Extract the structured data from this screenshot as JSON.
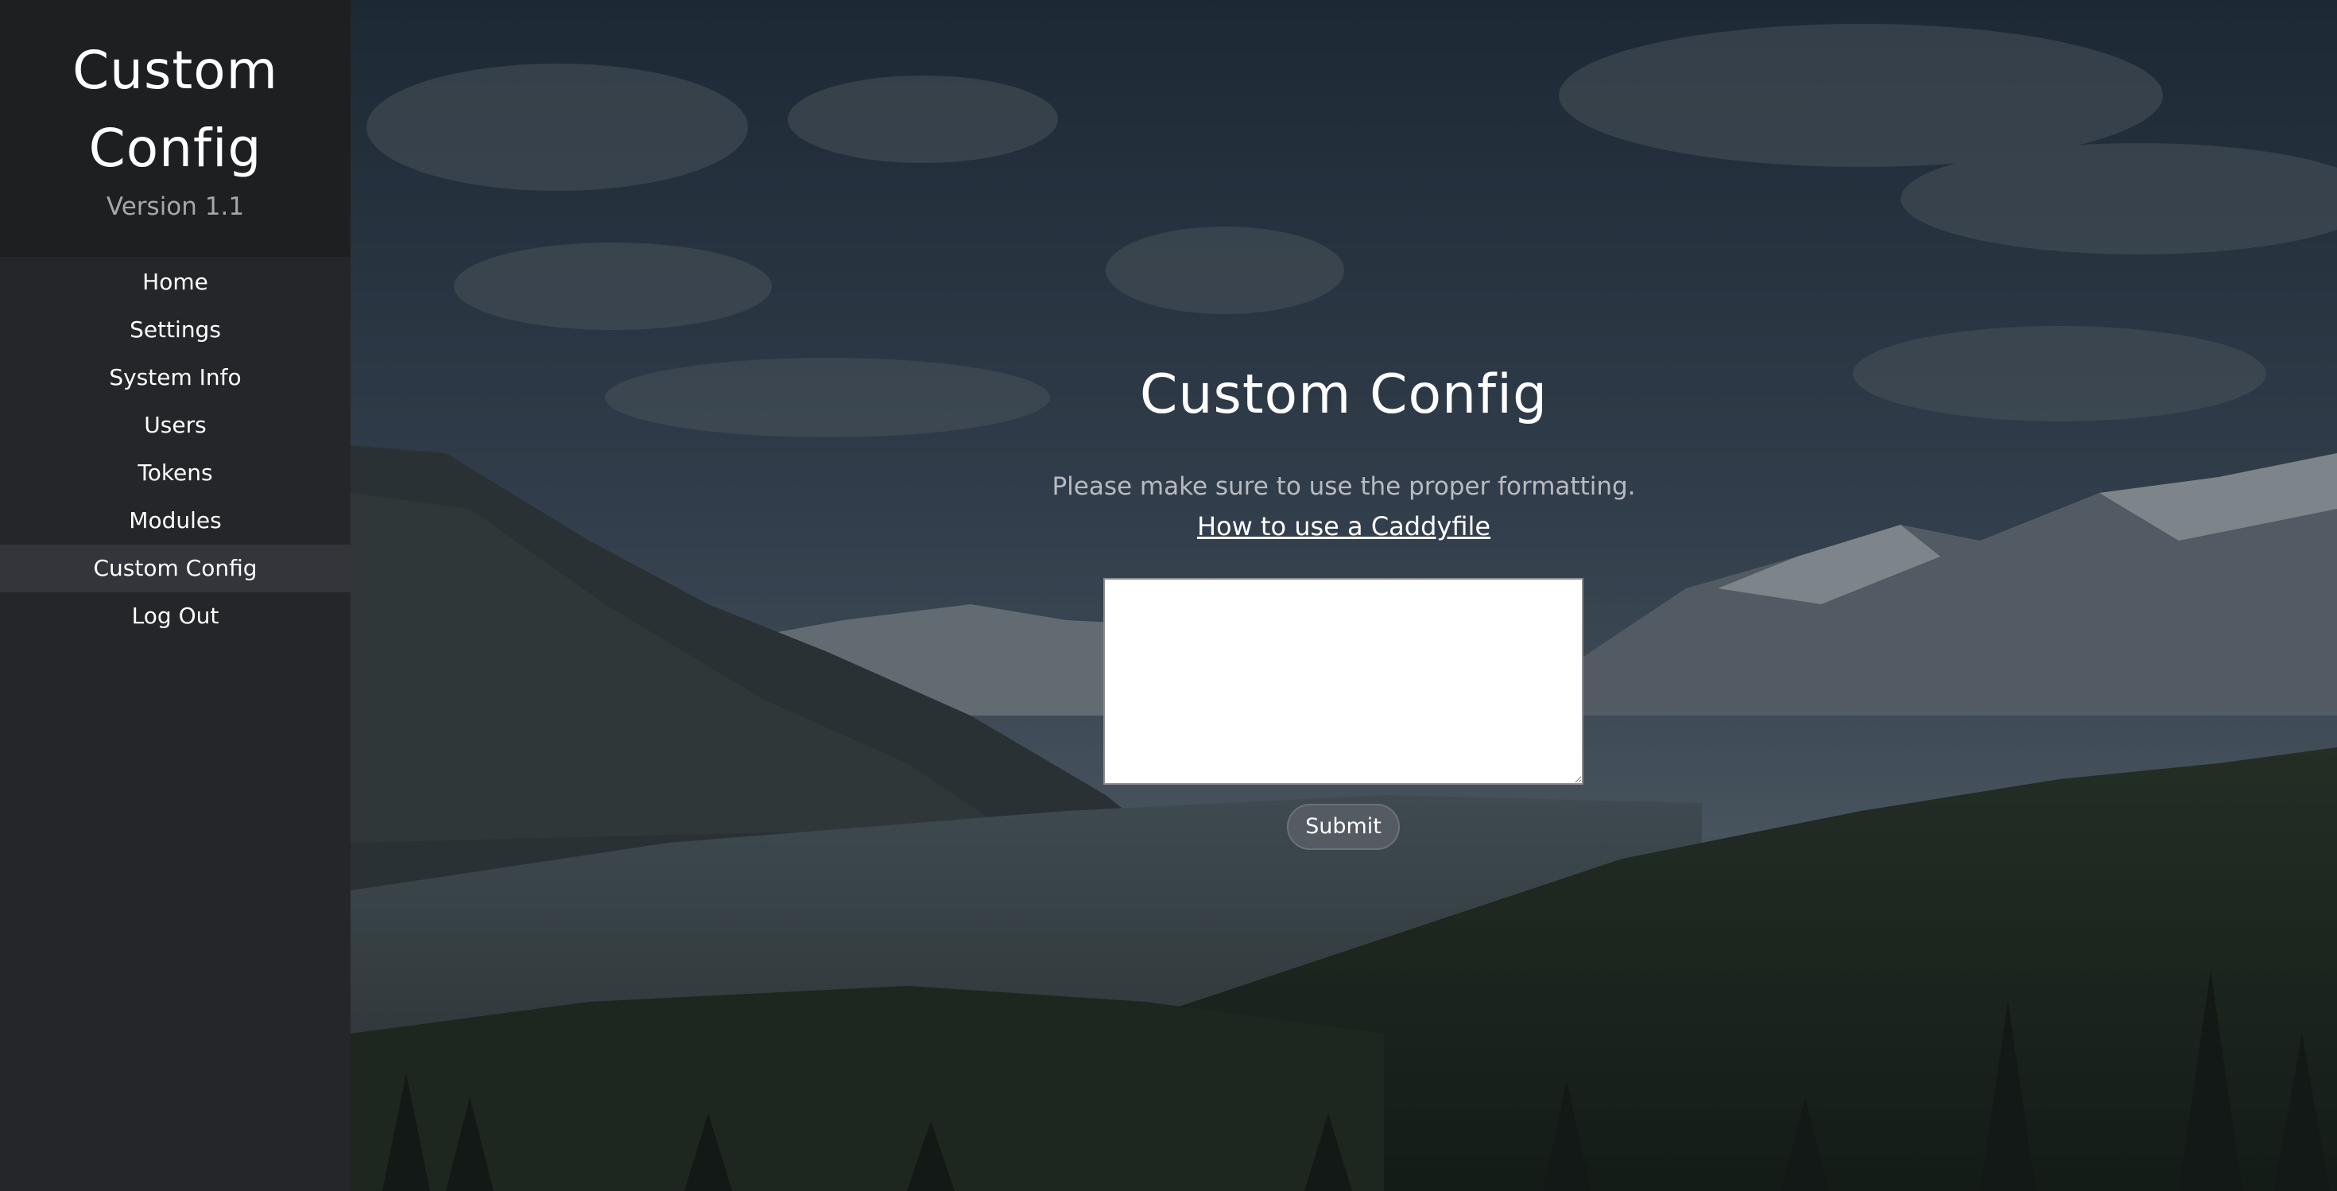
{
  "sidebar": {
    "title": "Custom Config",
    "version": "Version 1.1",
    "items": [
      {
        "label": "Home",
        "active": false
      },
      {
        "label": "Settings",
        "active": false
      },
      {
        "label": "System Info",
        "active": false
      },
      {
        "label": "Users",
        "active": false
      },
      {
        "label": "Tokens",
        "active": false
      },
      {
        "label": "Modules",
        "active": false
      },
      {
        "label": "Custom Config",
        "active": true
      },
      {
        "label": "Log Out",
        "active": false
      }
    ]
  },
  "main": {
    "title": "Custom Config",
    "hint": "Please make sure to use the proper formatting.",
    "help_link": "How to use a Caddyfile",
    "config_value": "",
    "submit_label": "Submit"
  },
  "colors": {
    "sidebar_bg": "#25262a",
    "sidebar_header_bg": "#1e1f21",
    "nav_active_bg": "#34353a",
    "button_bg": "#545b63"
  }
}
